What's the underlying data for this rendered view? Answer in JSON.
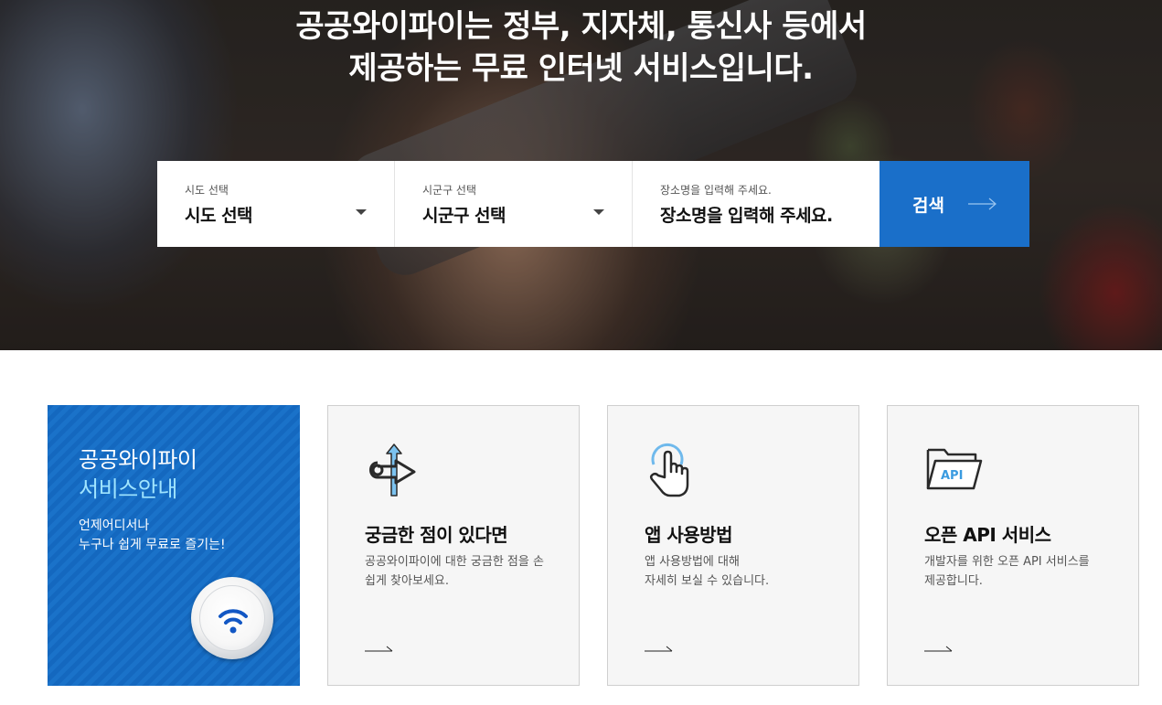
{
  "hero": {
    "line1": "공공와이파이는 정부, 지자체, 통신사 등에서",
    "line2": "제공하는 무료 인터넷 서비스입니다."
  },
  "search": {
    "sido": {
      "label": "시도 선택",
      "value": "시도 선택"
    },
    "sigungu": {
      "label": "시군구 선택",
      "value": "시군구 선택"
    },
    "place": {
      "label": "장소명을 입력해 주세요.",
      "placeholder": "장소명을 입력해 주세요."
    },
    "button_label": "검색"
  },
  "cards": {
    "service": {
      "title1": "공공와이파이",
      "title2": "서비스안내",
      "desc1": "언제어디서나",
      "desc2": "누구나 쉽게 무료로 즐기는!"
    },
    "faq": {
      "title": "궁금한 점이 있다면",
      "desc1": "공공와이파이에 대한 궁금한 점을 손",
      "desc2": "쉽게 찾아보세요."
    },
    "app": {
      "title": "앱 사용방법",
      "desc1": "앱 사용방법에 대해",
      "desc2": "자세히 보실 수 있습니다."
    },
    "api": {
      "title": "오픈 API 서비스",
      "desc1": "개발자를 위한 오픈 API 서비스를",
      "desc2": "제공합니다.",
      "icon_text": "API"
    }
  },
  "colors": {
    "primary": "#1a6fc9",
    "accent_text": "#9fe4ff",
    "card_bg": "#f6f6f6"
  },
  "icons": {
    "faq": "direction-arrows-icon",
    "app": "touch-hand-icon",
    "api": "api-folder-icon",
    "service": "wifi-icon",
    "more": "arrow-right-icon"
  }
}
